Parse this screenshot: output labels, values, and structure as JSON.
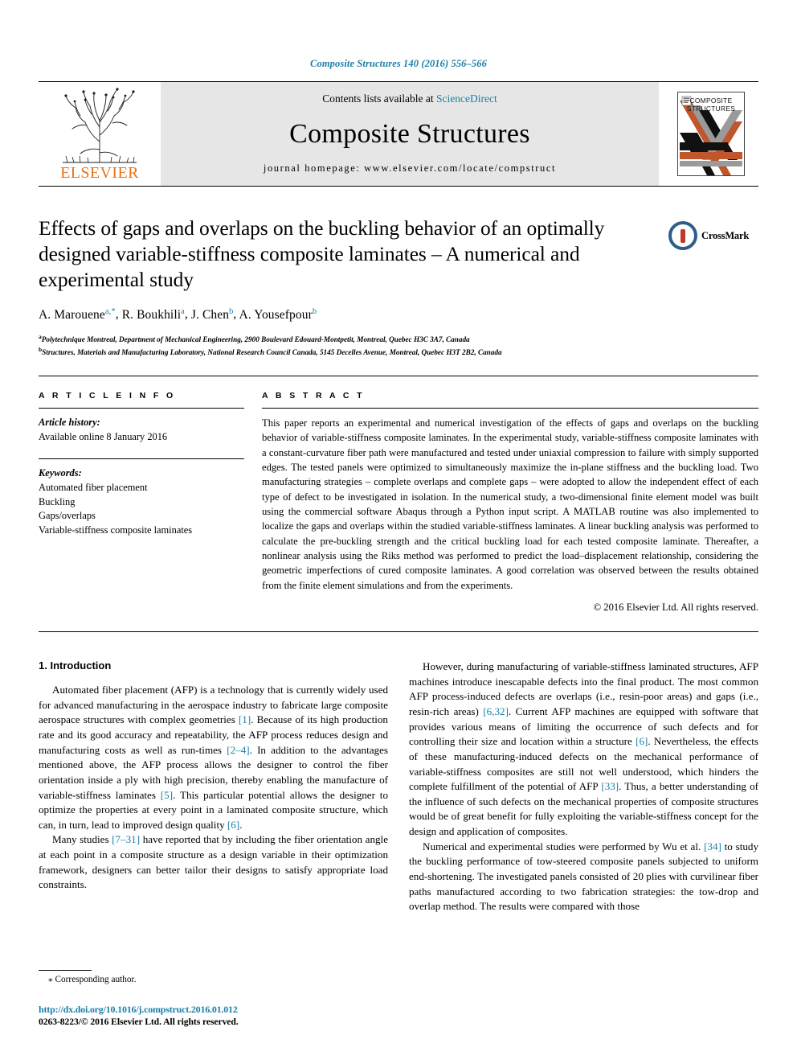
{
  "running_head": "Composite Structures 140 (2016) 556–566",
  "masthead": {
    "contents_prefix": "Contents lists available at ",
    "sciencedirect": "ScienceDirect",
    "journal_title": "Composite Structures",
    "homepage": "journal homepage: www.elsevier.com/locate/compstruct",
    "publisher_wordmark": "ELSEVIER",
    "cover_title_line1": "COMPOSITE",
    "cover_title_line2": "STRUCTURES",
    "tree_icon": "elsevier-tree-icon",
    "accent_orange": "#E9711C",
    "accent_link": "#1a7fa8",
    "masthead_bg": "#e6e6e6"
  },
  "title": "Effects of gaps and overlaps on the buckling behavior of an optimally designed variable-stiffness composite laminates – A numerical and experimental study",
  "crossmark": {
    "label": "CrossMark",
    "icon": "crossmark-logo-icon"
  },
  "authors": [
    {
      "name": "A. Marouene",
      "sup": "a,*"
    },
    {
      "name": "R. Boukhili",
      "sup": "a"
    },
    {
      "name": "J. Chen",
      "sup": "b"
    },
    {
      "name": "A. Yousefpour",
      "sup": "b"
    }
  ],
  "affiliations": [
    {
      "marker": "a",
      "text": "Polytechnique Montreal, Department of Mechanical Engineering, 2900 Boulevard Edouard-Montpetit, Montreal, Quebec H3C 3A7, Canada"
    },
    {
      "marker": "b",
      "text": "Structures, Materials and Manufacturing Laboratory, National Research Council Canada, 5145 Decelles Avenue, Montreal, Quebec H3T 2B2, Canada"
    }
  ],
  "article_info": {
    "heading": "A R T I C L E   I N F O",
    "history_label": "Article history:",
    "history_value": "Available online 8 January 2016",
    "keywords_label": "Keywords:",
    "keywords": [
      "Automated fiber placement",
      "Buckling",
      "Gaps/overlaps",
      "Variable-stiffness composite laminates"
    ]
  },
  "abstract": {
    "heading": "A B S T R A C T",
    "text": "This paper reports an experimental and numerical investigation of the effects of gaps and overlaps on the buckling behavior of variable-stiffness composite laminates. In the experimental study, variable-stiffness composite laminates with a constant-curvature fiber path were manufactured and tested under uniaxial compression to failure with simply supported edges. The tested panels were optimized to simultaneously maximize the in-plane stiffness and the buckling load. Two manufacturing strategies – complete overlaps and complete gaps – were adopted to allow the independent effect of each type of defect to be investigated in isolation. In the numerical study, a two-dimensional finite element model was built using the commercial software Abaqus through a Python input script. A MATLAB routine was also implemented to localize the gaps and overlaps within the studied variable-stiffness laminates. A linear buckling analysis was performed to calculate the pre-buckling strength and the critical buckling load for each tested composite laminate. Thereafter, a nonlinear analysis using the Riks method was performed to predict the load–displacement relationship, considering the geometric imperfections of cured composite laminates. A good correlation was observed between the results obtained from the finite element simulations and from the experiments.",
    "copyright": "© 2016 Elsevier Ltd. All rights reserved."
  },
  "section": {
    "number_title": "1. Introduction"
  },
  "body": {
    "left": [
      "Automated fiber placement (AFP) is a technology that is currently widely used for advanced manufacturing in the aerospace industry to fabricate large composite aerospace structures with complex geometries [1]. Because of its high production rate and its good accuracy and repeatability, the AFP process reduces design and manufacturing costs as well as run-times [2–4]. In addition to the advantages mentioned above, the AFP process allows the designer to control the fiber orientation inside a ply with high precision, thereby enabling the manufacture of variable-stiffness laminates [5]. This particular potential allows the designer to optimize the properties at every point in a laminated composite structure, which can, in turn, lead to improved design quality [6].",
      "Many studies [7–31] have reported that by including the fiber orientation angle at each point in a composite structure as a design variable in their optimization framework, designers can better tailor their designs to satisfy appropriate load constraints."
    ],
    "right": [
      "However, during manufacturing of variable-stiffness laminated structures, AFP machines introduce inescapable defects into the final product. The most common AFP process-induced defects are overlaps (i.e., resin-poor areas) and gaps (i.e., resin-rich areas) [6,32]. Current AFP machines are equipped with software that provides various means of limiting the occurrence of such defects and for controlling their size and location within a structure [6]. Nevertheless, the effects of these manufacturing-induced defects on the mechanical performance of variable-stiffness composites are still not well understood, which hinders the complete fulfillment of the potential of AFP [33]. Thus, a better understanding of the influence of such defects on the mechanical properties of composite structures would be of great benefit for fully exploiting the variable-stiffness concept for the design and application of composites.",
      "Numerical and experimental studies were performed by Wu et al. [34] to study the buckling performance of tow-steered composite panels subjected to uniform end-shortening. The investigated panels consisted of 20 plies with curvilinear fiber paths manufactured according to two fabrication strategies: the tow-drop and overlap method. The results were compared with those"
    ]
  },
  "footer": {
    "corresponding_marker": "⁎",
    "corresponding_text": "Corresponding author.",
    "doi": "http://dx.doi.org/10.1016/j.compstruct.2016.01.012",
    "issn": "0263-8223/© 2016 Elsevier Ltd. All rights reserved."
  }
}
